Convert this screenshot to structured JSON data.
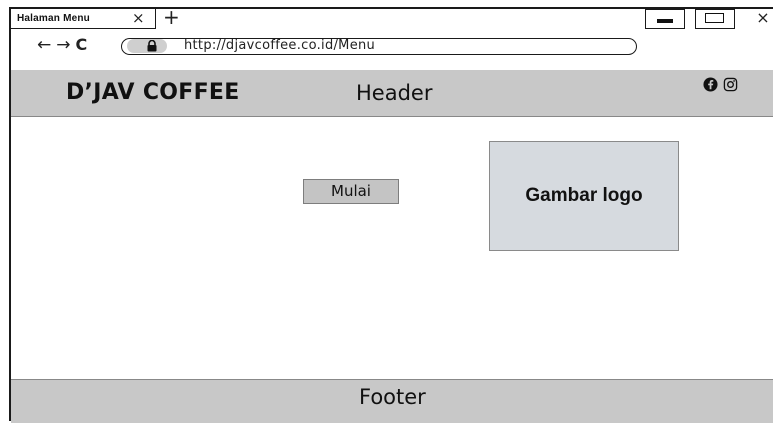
{
  "tab": {
    "title": "Halaman Menu",
    "close_glyph": "×",
    "new_tab_glyph": "+"
  },
  "window_controls": {
    "close_glyph": "×",
    "icons": [
      "minimize-icon",
      "maximize-icon",
      "close-icon"
    ]
  },
  "navigation": {
    "back_glyph": "←",
    "forward_glyph": "→",
    "reload_glyph": "C",
    "url": "http://djavcoffee.co.id/Menu"
  },
  "header": {
    "brand": "D’JAV COFFEE",
    "label": "Header",
    "social_icons": [
      "facebook-icon",
      "instagram-icon"
    ]
  },
  "main": {
    "start_button": "Mulai",
    "logo_placeholder": "Gambar logo"
  },
  "footer": {
    "label": "Footer"
  },
  "colors": {
    "bar_gray": "#c8c8c8",
    "button_gray": "#c4c4c4",
    "logo_box": "#d6dadf",
    "lock_cap": "#cfcfcf"
  }
}
